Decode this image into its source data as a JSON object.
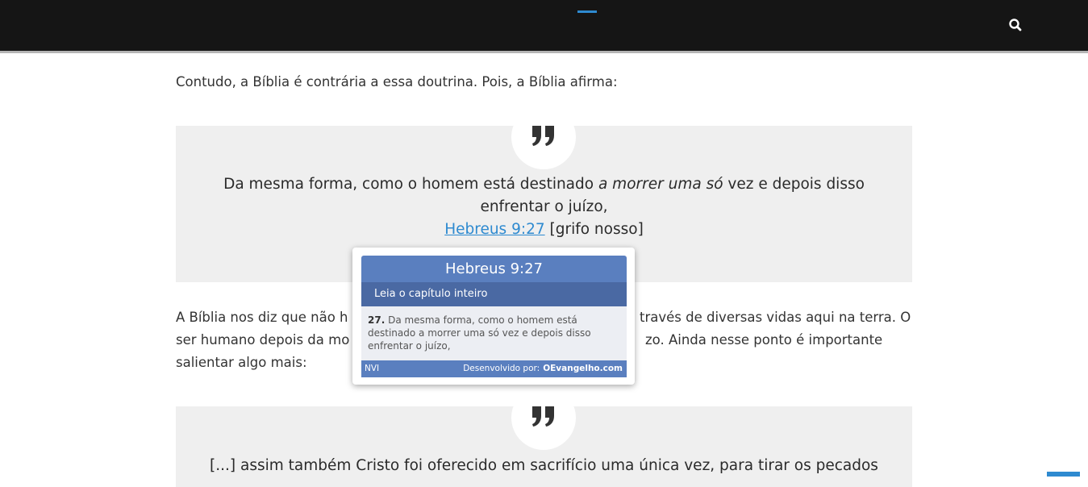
{
  "header": {
    "search_icon": "search-icon"
  },
  "article": {
    "paragraph_1": "Contudo, a Bíblia é contrária a essa doutrina. Pois, a Bíblia afirma:",
    "quote_1": {
      "text_before": "Da mesma forma, como o homem está destinado ",
      "text_emphasis": "a morrer uma só",
      "text_after": " vez e depois disso enfrentar o juízo,",
      "reference": "Hebreus 9:27",
      "note": " [grifo nosso]"
    },
    "paragraph_2": "A Bíblia nos diz que não há ... através de diversas vidas aqui na terra. O ser humano depois da morte ... juízo. Ainda nesse ponto é importante salientar algo mais:",
    "paragraph_2_left": "A Bíblia nos diz que não h",
    "paragraph_2_right": "través de diversas vidas aqui na terra. O",
    "paragraph_2_line2_left": "ser humano depois da mo",
    "paragraph_2_line2_right": "zo. Ainda nesse ponto é importante",
    "paragraph_2_line3": "salientar algo mais:",
    "quote_2": {
      "text": "[...] assim também Cristo foi oferecido em sacrifício uma única vez, para tirar os pecados"
    }
  },
  "tooltip": {
    "title": "Hebreus 9:27",
    "chapter_link": "Leia o capítulo inteiro",
    "verse_number": "27.",
    "verse_text": " Da mesma forma, como o homem está destinado a morrer uma só vez e depois disso enfrentar o juízo,",
    "version": "NVI",
    "developed_by": "Desenvolvido por:",
    "brand": "OEvangelho.com"
  },
  "colors": {
    "accent": "#2e8ad0",
    "header_bg": "#151515",
    "tooltip_blue": "#5a7fbf",
    "quote_bg": "#efefef"
  }
}
